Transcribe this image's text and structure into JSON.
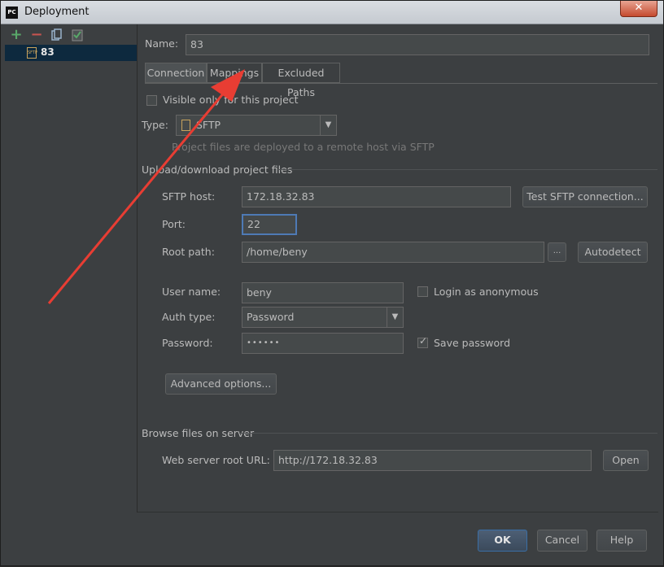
{
  "window": {
    "title": "Deployment",
    "app_icon": "PC",
    "close": "✕"
  },
  "left_toolbar": {
    "add_icon": "+",
    "remove_icon": "−",
    "copy_icon": "copy",
    "default_icon": "default"
  },
  "servers": [
    {
      "label": "83",
      "icon_text": "SFTP"
    }
  ],
  "name": {
    "label": "Name:",
    "value": "83"
  },
  "tabs": [
    {
      "label": "Connection"
    },
    {
      "label": "Mappings"
    },
    {
      "label": "Excluded Paths"
    }
  ],
  "visible_only": {
    "label": "Visible only for this project",
    "checked": false
  },
  "type": {
    "label": "Type:",
    "value": "SFTP",
    "hint": "Project files are deployed to a remote host via SFTP"
  },
  "upload_section": {
    "title": "Upload/download project files"
  },
  "sftp_host": {
    "label": "SFTP host:",
    "value": "172.18.32.83"
  },
  "test_button": {
    "label": "Test SFTP connection..."
  },
  "port": {
    "label": "Port:",
    "value": "22"
  },
  "root_path": {
    "label": "Root path:",
    "value": "/home/beny",
    "browse": "...",
    "autodetect": "Autodetect"
  },
  "user_name": {
    "label": "User name:",
    "value": "beny"
  },
  "login_anonymous": {
    "label": "Login as anonymous",
    "checked": false
  },
  "auth_type": {
    "label": "Auth type:",
    "value": "Password"
  },
  "password": {
    "label": "Password:",
    "value": "••••••"
  },
  "save_password": {
    "label": "Save password",
    "checked": true
  },
  "advanced": {
    "label": "Advanced options..."
  },
  "browse_section": {
    "title": "Browse files on server"
  },
  "web_root": {
    "label": "Web server root URL:",
    "value": "http://172.18.32.83",
    "open": "Open"
  },
  "footer": {
    "ok": "OK",
    "cancel": "Cancel",
    "help": "Help"
  },
  "colors": {
    "background": "#3c3f41",
    "field": "#45494a",
    "selection": "#0d293e",
    "annotation_arrow": "#e83d33"
  }
}
